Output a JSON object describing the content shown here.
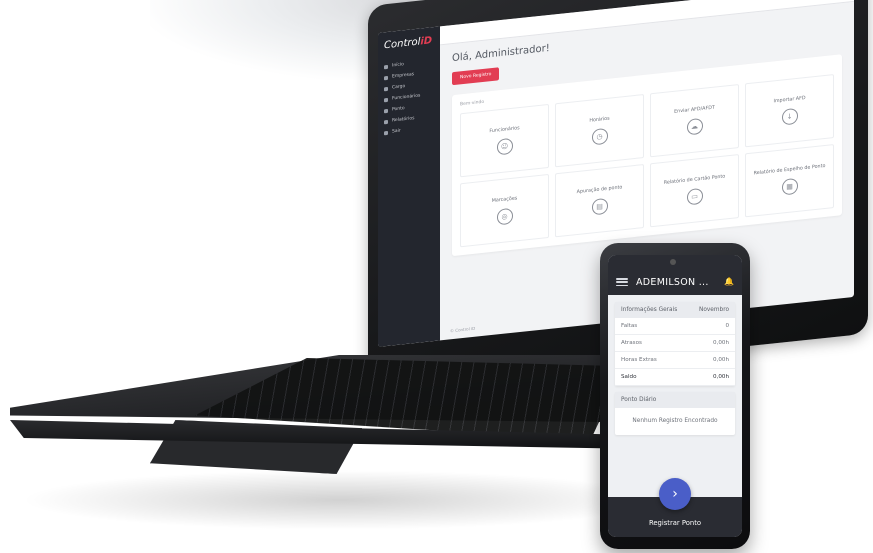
{
  "desktop_app": {
    "logo_text": "Control",
    "logo_accent": "iD",
    "sidebar_items": [
      "Início",
      "Empresas",
      "Cargo",
      "Funcionários",
      "Ponto",
      "Relatórios",
      "Sair"
    ],
    "greeting": "Olá, Administrador!",
    "primary_button": "Novo Registro",
    "panel_caption": "Bem-vindo",
    "cards": [
      {
        "title": "Funcionários",
        "icon": "user-icon"
      },
      {
        "title": "Horários",
        "icon": "clock-icon"
      },
      {
        "title": "Enviar AFD/AFDT",
        "icon": "cloud-icon"
      },
      {
        "title": "Importar AFD",
        "icon": "import-icon"
      },
      {
        "title": "Marcações",
        "icon": "fingerprint-icon"
      },
      {
        "title": "Apuração de ponto",
        "icon": "calc-icon"
      },
      {
        "title": "Relatório de Cartão Ponto",
        "icon": "card-icon"
      },
      {
        "title": "Relatório de Espelho de Ponto",
        "icon": "report-icon"
      }
    ],
    "footer": "© Control iD"
  },
  "mobile_app": {
    "user": "ADEMILSON ...",
    "info_card": {
      "title": "Informações Gerais",
      "month": "Novembro",
      "rows": [
        {
          "label": "Faltas",
          "value": "0"
        },
        {
          "label": "Atrasos",
          "value": "0,00h"
        },
        {
          "label": "Horas Extras",
          "value": "0,00h"
        }
      ],
      "total": {
        "label": "Saldo",
        "value": "0,00h"
      }
    },
    "daily_card": {
      "title": "Ponto Diário",
      "empty_message": "Nenhum Registro Encontrado"
    },
    "register_label": "Registrar Ponto",
    "fab_icon": "chevron-right-icon"
  },
  "colors": {
    "accent_red": "#e23d53",
    "sidebar_dark": "#23262e",
    "mobile_header": "#2a2c33",
    "fab_blue": "#4a5ec8"
  }
}
